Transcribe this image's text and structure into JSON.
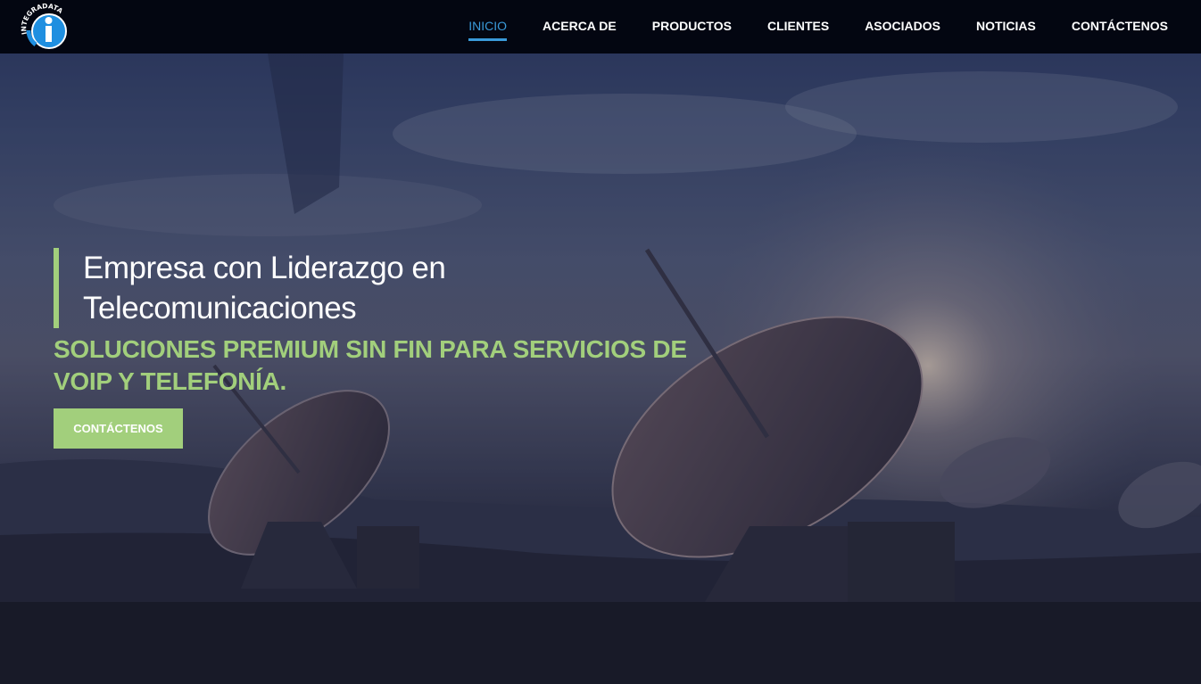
{
  "brand": {
    "logo_text": "INTEGRADATA",
    "logo_glyph": "i"
  },
  "nav": {
    "items": [
      {
        "label": "INICIO",
        "active": true
      },
      {
        "label": "ACERCA DE",
        "active": false
      },
      {
        "label": "PRODUCTOS",
        "active": false
      },
      {
        "label": "CLIENTES",
        "active": false
      },
      {
        "label": "ASOCIADOS",
        "active": false
      },
      {
        "label": "NOTICIAS",
        "active": false
      },
      {
        "label": "CONTÁCTENOS",
        "active": false
      }
    ]
  },
  "hero": {
    "headline": "Empresa con Liderazgo en Telecomunicaciones",
    "subheadline": "SOLUCIONES PREMIUM SIN FIN PARA SERVICIOS DE VOIP Y TELEFONÍA.",
    "cta_label": "CONTÁCTENOS"
  },
  "colors": {
    "accent_green": "#a2cf7c",
    "nav_active": "#3a9ad9",
    "topbar_bg": "#02050e",
    "logo_blue": "#1f8fe0"
  }
}
